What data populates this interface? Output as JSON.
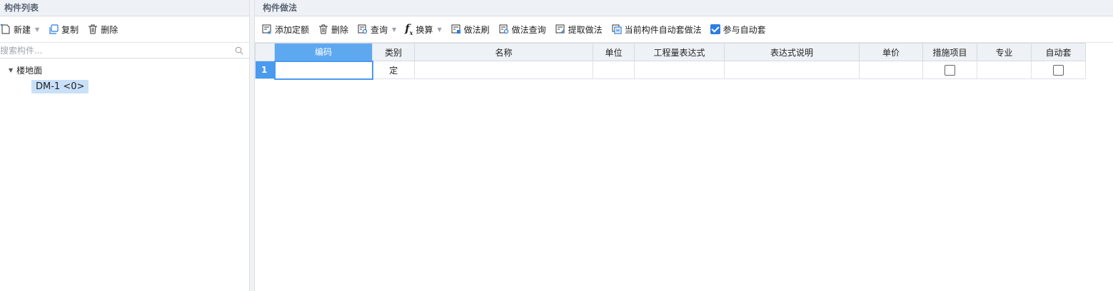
{
  "left_panel": {
    "title": "构件列表",
    "toolbar": {
      "new_label": "新建",
      "copy_label": "复制",
      "delete_label": "删除"
    },
    "search": {
      "placeholder": "搜索构件..."
    },
    "tree": {
      "group_label": "楼地面",
      "items": [
        {
          "label": "DM-1 <0>"
        }
      ]
    }
  },
  "right_panel": {
    "title": "构件做法",
    "toolbar": {
      "add_quota_label": "添加定额",
      "delete_label": "删除",
      "query_label": "查询",
      "convert_label": "换算",
      "method_brush_label": "做法刷",
      "method_query_label": "做法查询",
      "extract_method_label": "提取做法",
      "auto_method_label": "当前构件自动套做法",
      "participate_auto_label": "参与自动套",
      "participate_auto_checked": true
    },
    "grid": {
      "columns": [
        "编码",
        "类别",
        "名称",
        "单位",
        "工程量表达式",
        "表达式说明",
        "单价",
        "措施项目",
        "专业",
        "自动套"
      ],
      "rows": [
        {
          "num": "1",
          "code": "",
          "category": "定",
          "name": "",
          "unit": "",
          "expr": "",
          "expr_desc": "",
          "price": "",
          "measure": false,
          "specialty": "",
          "auto": false
        }
      ]
    }
  },
  "colors": {
    "accent": "#4a9af0",
    "selected_item": "#c9e0f9",
    "header_bg": "#eef1f6"
  }
}
